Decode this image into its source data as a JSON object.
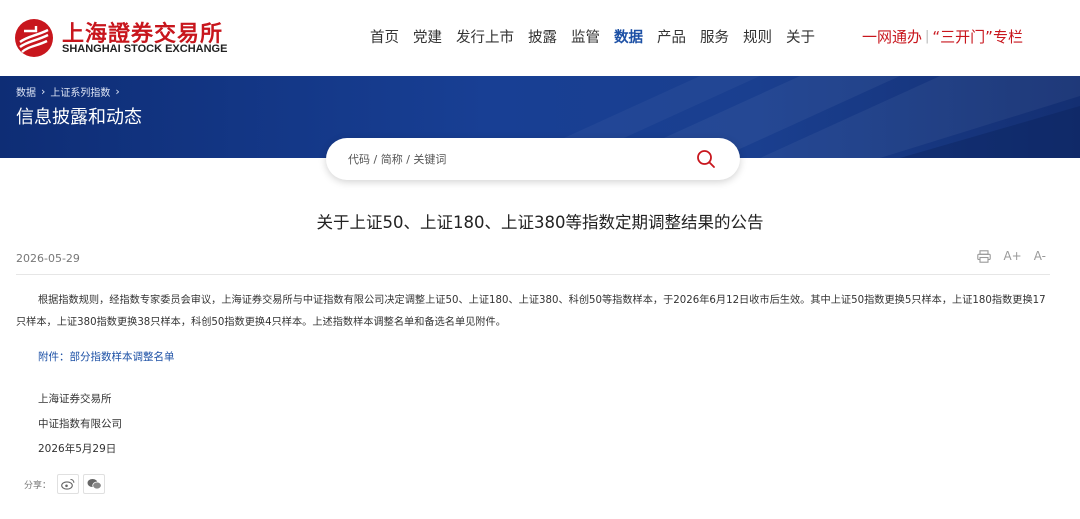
{
  "header": {
    "logo_cn": "上海證券交易所",
    "logo_en": "SHANGHAI STOCK EXCHANGE",
    "nav": [
      "首页",
      "党建",
      "发行上市",
      "披露",
      "监管",
      "数据",
      "产品",
      "服务",
      "规则",
      "关于"
    ],
    "active_nav": "数据",
    "special_left": "一网通办",
    "special_sep": "|",
    "special_right": "“三开门”专栏",
    "brand_color": "#c8161d",
    "accent_color": "#1c50a5"
  },
  "banner": {
    "breadcrumb": [
      "数据",
      "上证系列指数"
    ],
    "title": "信息披露和动态"
  },
  "search": {
    "placeholder": "代码 / 简称 / 关键词"
  },
  "article": {
    "title": "关于上证50、上证180、上证380等指数定期调整结果的公告",
    "date": "2026-05-29",
    "tools": [
      "A+",
      "A-"
    ],
    "body": "根据指数规则，经指数专家委员会审议，上海证券交易所与中证指数有限公司决定调整上证50、上证180、上证380、科创50等指数样本，于2026年6月12日收市后生效。其中上证50指数更换5只样本，上证180指数更换17只样本，上证380指数更换38只样本，科创50指数更换4只样本。上述指数样本调整名单和备选名单见附件。",
    "attachment": "附件：部分指数样本调整名单",
    "signatures": [
      "上海证券交易所",
      "中证指数有限公司",
      "2026年5月29日"
    ],
    "share_label": "分享："
  }
}
